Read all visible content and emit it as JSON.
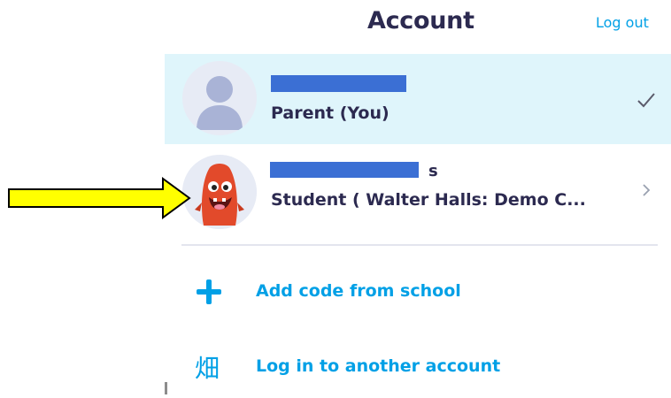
{
  "header": {
    "title": "Account",
    "logout_label": "Log out"
  },
  "accounts": [
    {
      "name_suffix": "",
      "role": "Parent (You)",
      "avatar": "person-silhouette-icon",
      "selected": true,
      "trailing_icon": "checkmark-icon"
    },
    {
      "name_suffix": "s",
      "role": "Student ( Walter Halls: Demo C...",
      "avatar": "red-monster-avatar",
      "selected": false,
      "trailing_icon": "chevron-right-icon"
    }
  ],
  "actions": [
    {
      "label": "Add code from school",
      "icon": "plus-icon"
    },
    {
      "label": "Log in to another account",
      "icon": "kanji-icon",
      "glyph": "畑"
    }
  ],
  "annotation": {
    "icon": "yellow-arrow-icon"
  },
  "colors": {
    "accent": "#00a0e6",
    "selected_row_bg": "#dff5fb",
    "redaction": "#3b6fd4",
    "title_text": "#2c2a50",
    "arrow_fill": "#ffff00"
  }
}
